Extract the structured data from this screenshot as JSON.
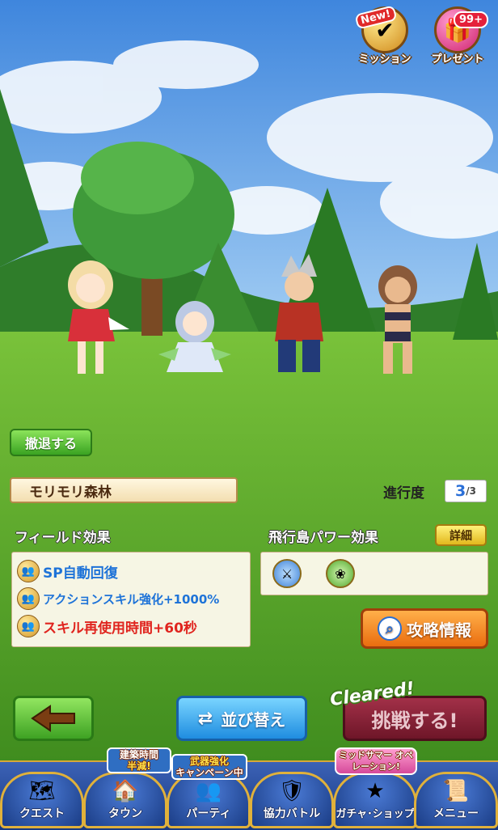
{
  "hud": {
    "mission_label": "ミッション",
    "mission_badge": "New!",
    "present_label": "プレゼント",
    "present_badge": "99+"
  },
  "retreat_label": "撤退する",
  "area": {
    "name": "モリモリ森林",
    "progress_label": "進行度",
    "progress_current": "3",
    "progress_total": "/3"
  },
  "field_effects": {
    "title": "フィールド効果",
    "items": [
      {
        "text": "SP自動回復",
        "color": "#1e73d8"
      },
      {
        "text": "アクションスキル強化+1000%",
        "color": "#1e73d8"
      },
      {
        "text": "スキル再使用時間+60秒",
        "color": "#e0241e"
      }
    ]
  },
  "island_power": {
    "title": "飛行島パワー効果",
    "detail_label": "詳細",
    "icons": [
      "attack-boost-icon",
      "nature-element-icon"
    ]
  },
  "strategy_label": "攻略情報",
  "actions": {
    "sort_label": "並び替え",
    "challenge_label": "挑戦する!",
    "cleared_label": "Cleared!"
  },
  "nav": {
    "items": [
      {
        "label": "クエスト",
        "icon": "quest-map-icon"
      },
      {
        "label": "タウン",
        "icon": "town-icon"
      },
      {
        "label": "パーティ",
        "icon": "party-icon"
      },
      {
        "label": "協力バトル",
        "icon": "coop-battle-icon"
      },
      {
        "label": "ガチャ･ショップ",
        "icon": "gacha-shop-icon"
      },
      {
        "label": "メニュー",
        "icon": "menu-scroll-icon"
      }
    ],
    "town_badge": {
      "line1": "建築時間",
      "line2": "半減!"
    },
    "party_badge": {
      "line1": "武器強化",
      "line2": "キャンペーン中"
    },
    "gacha_badge": "ミッドサマー オペレーション!"
  },
  "colors": {
    "sky": "#5d9fe6",
    "grass": "#5aa92a",
    "accent_orange": "#ea6d0f",
    "nav_blue": "#1b3d86"
  }
}
